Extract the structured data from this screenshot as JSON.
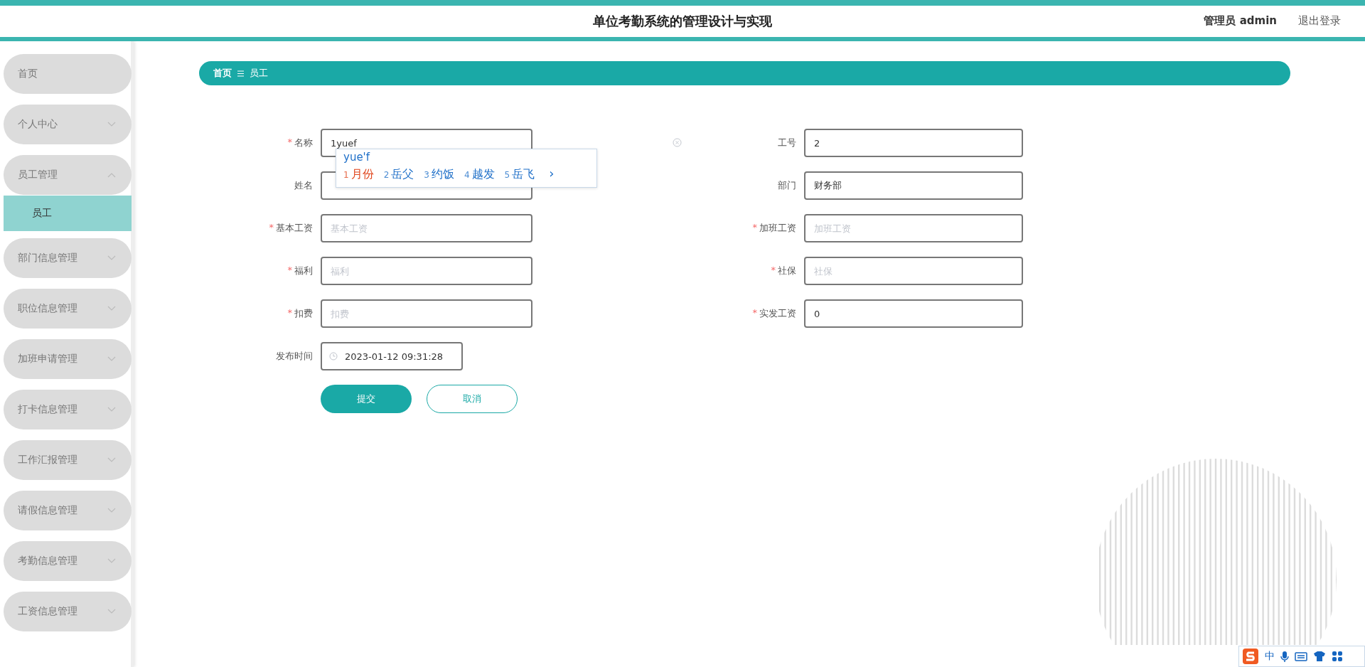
{
  "header": {
    "title": "单位考勤系统的管理设计与实现",
    "user": "管理员 admin",
    "logout": "退出登录"
  },
  "sidebar": {
    "items": [
      {
        "label": "首页",
        "kind": "link"
      },
      {
        "label": "个人中心",
        "kind": "group",
        "expanded": false
      },
      {
        "label": "员工管理",
        "kind": "group",
        "expanded": true,
        "children": [
          {
            "label": "员工",
            "selected": true
          }
        ]
      },
      {
        "label": "部门信息管理",
        "kind": "group",
        "expanded": false
      },
      {
        "label": "职位信息管理",
        "kind": "group",
        "expanded": false
      },
      {
        "label": "加班申请管理",
        "kind": "group",
        "expanded": false
      },
      {
        "label": "打卡信息管理",
        "kind": "group",
        "expanded": false
      },
      {
        "label": "工作汇报管理",
        "kind": "group",
        "expanded": false
      },
      {
        "label": "请假信息管理",
        "kind": "group",
        "expanded": false
      },
      {
        "label": "考勤信息管理",
        "kind": "group",
        "expanded": false
      },
      {
        "label": "工资信息管理",
        "kind": "group",
        "expanded": false
      }
    ]
  },
  "breadcrumb": [
    "首页",
    "员工"
  ],
  "form": {
    "fields": [
      {
        "label": "名称",
        "required_mark": "*",
        "value": "1yuef",
        "kind": "text"
      },
      {
        "label": "工号",
        "value": "2",
        "kind": "text"
      },
      {
        "label": "姓名",
        "kind": "text"
      },
      {
        "label": "部门",
        "value": "财务部",
        "kind": "text"
      },
      {
        "label": "基本工资",
        "required_mark": "*",
        "placeholder": "基本工资",
        "kind": "text"
      },
      {
        "label": "加班工资",
        "required_mark": "*",
        "placeholder": "加班工资",
        "kind": "text"
      },
      {
        "label": "福利",
        "required_mark": "*",
        "placeholder": "福利",
        "kind": "text"
      },
      {
        "label": "社保",
        "required_mark": "*",
        "placeholder": "社保",
        "kind": "text"
      },
      {
        "label": "扣费",
        "required_mark": "*",
        "placeholder": "扣费",
        "kind": "text"
      },
      {
        "label": "实发工资",
        "required_mark": "*",
        "value": "0",
        "kind": "text"
      },
      {
        "label": "发布时间",
        "value": "2023-01-12 09:31:28",
        "kind": "date"
      }
    ],
    "buttons": [
      {
        "label": "提交",
        "kind": "primary"
      },
      {
        "label": "取消",
        "kind": "plain"
      }
    ]
  },
  "ime_popup": {
    "composition": "yue'f",
    "candidates": [
      {
        "index": "1",
        "text": "月份",
        "selected": true
      },
      {
        "index": "2",
        "text": "岳父",
        "selected": false
      },
      {
        "index": "3",
        "text": "约饭",
        "selected": false
      },
      {
        "index": "4",
        "text": "越发",
        "selected": false
      },
      {
        "index": "5",
        "text": "岳飞",
        "selected": false
      }
    ],
    "next": "›"
  },
  "ime_toolbar": {
    "mode": "中"
  }
}
